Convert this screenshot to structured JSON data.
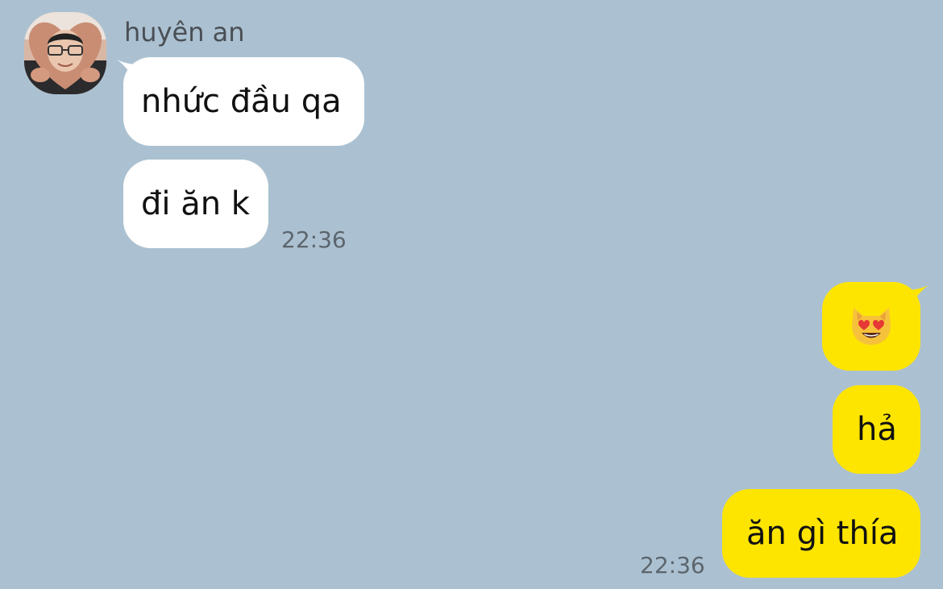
{
  "conversation": {
    "sender": {
      "name": "huyên an"
    },
    "incoming": [
      {
        "text": "nhức đầu qa"
      },
      {
        "text": "đi ăn k"
      }
    ],
    "incoming_time": "22:36",
    "outgoing": [
      {
        "emoji": "smiling-cat-heart-eyes"
      },
      {
        "text": "hả"
      },
      {
        "text": "ăn gì thía"
      }
    ],
    "outgoing_time": "22:36"
  },
  "colors": {
    "background": "#abc1d1",
    "incoming_bubble": "#ffffff",
    "outgoing_bubble": "#fee500",
    "timestamp": "#5c656d"
  }
}
